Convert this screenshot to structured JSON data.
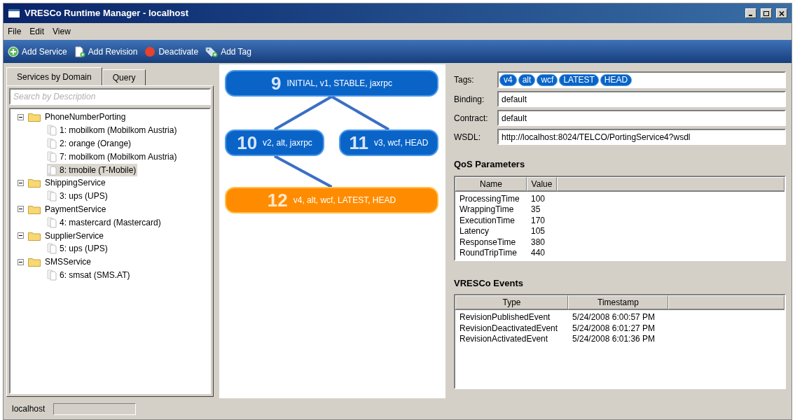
{
  "window": {
    "title": "VRESCo Runtime Manager - localhost"
  },
  "menu": [
    "File",
    "Edit",
    "View"
  ],
  "toolbar": [
    {
      "kind": "add",
      "label": "Add Service"
    },
    {
      "kind": "page",
      "label": "Add Revision"
    },
    {
      "kind": "stop",
      "label": "Deactivate"
    },
    {
      "kind": "tag",
      "label": "Add Tag"
    }
  ],
  "tabs": [
    {
      "label": "Services by Domain",
      "selected": true
    },
    {
      "label": "Query",
      "selected": false
    }
  ],
  "search": {
    "placeholder": "Search by Description"
  },
  "tree": [
    {
      "label": "PhoneNumberPorting",
      "expanded": true,
      "children": [
        {
          "label": "1: mobilkom (Mobilkom Austria)",
          "selected": false
        },
        {
          "label": "2: orange (Orange)",
          "selected": false
        },
        {
          "label": "7: mobilkom (Mobilkom Austria)",
          "selected": false
        },
        {
          "label": "8: tmobile (T-Mobile)",
          "selected": true
        }
      ]
    },
    {
      "label": "ShippingService",
      "expanded": true,
      "children": [
        {
          "label": "3: ups (UPS)",
          "selected": false
        }
      ]
    },
    {
      "label": "PaymentService",
      "expanded": true,
      "children": [
        {
          "label": "4: mastercard (Mastercard)",
          "selected": false
        }
      ]
    },
    {
      "label": "SupplierService",
      "expanded": true,
      "children": [
        {
          "label": "5: ups (UPS)",
          "selected": false
        }
      ]
    },
    {
      "label": "SMSService",
      "expanded": true,
      "children": [
        {
          "label": "6: smsat (SMS.AT)",
          "selected": false
        }
      ]
    }
  ],
  "revisions": [
    {
      "number": "9",
      "tags": "INITIAL, v1, STABLE, jaxrpc",
      "selected": false,
      "children": [
        {
          "number": "10",
          "tags": "v2, alt, jaxrpc",
          "selected": false,
          "children": [
            {
              "number": "12",
              "tags": "v4, alt, wcf, LATEST, HEAD",
              "selected": true
            }
          ]
        },
        {
          "number": "11",
          "tags": "v3, wcf, HEAD",
          "selected": false
        }
      ]
    }
  ],
  "details": {
    "tags_label": "Tags:",
    "tags": [
      "v4",
      "alt",
      "wcf",
      "LATEST",
      "HEAD"
    ],
    "fields": [
      {
        "label": "Binding:",
        "value": "default"
      },
      {
        "label": "Contract:",
        "value": "default"
      },
      {
        "label": "WSDL:",
        "value": "http://localhost:8024/TELCO/PortingService4?wsdl"
      }
    ]
  },
  "qos": {
    "title": "QoS Parameters",
    "columns": [
      "Name",
      "Value"
    ],
    "rows": [
      [
        "ProcessingTime",
        "100"
      ],
      [
        "WrappingTime",
        "35"
      ],
      [
        "ExecutionTime",
        "170"
      ],
      [
        "Latency",
        "105"
      ],
      [
        "ResponseTime",
        "380"
      ],
      [
        "RoundTripTime",
        "440"
      ]
    ]
  },
  "events": {
    "title": "VRESCo Events",
    "columns": [
      "Type",
      "Timestamp"
    ],
    "rows": [
      [
        "RevisionPublishedEvent",
        "5/24/2008 6:00:57 PM"
      ],
      [
        "RevisionDeactivatedEvent",
        "5/24/2008 6:01:27 PM"
      ],
      [
        "RevisionActivatedEvent",
        "5/24/2008 6:01:36 PM"
      ]
    ]
  },
  "status_bar": {
    "text": "localhost"
  }
}
